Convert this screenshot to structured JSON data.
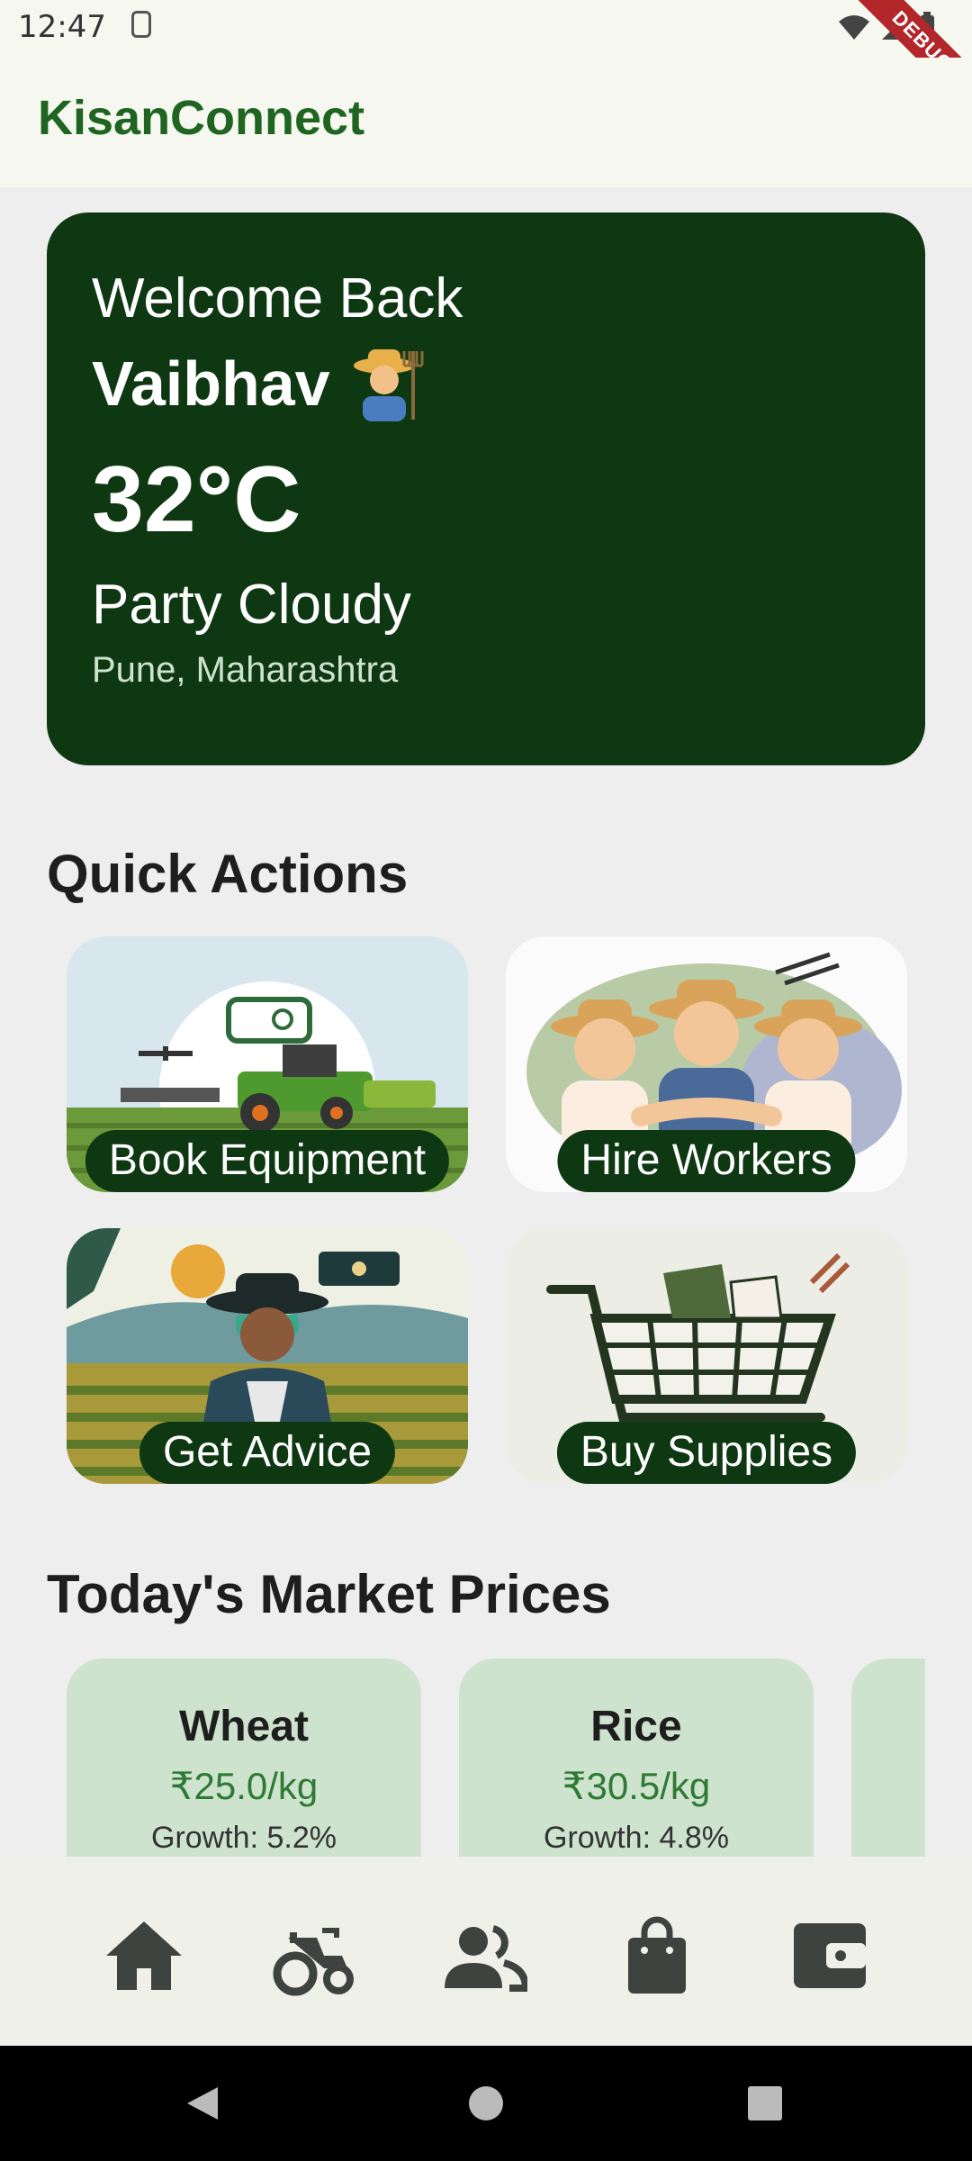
{
  "status": {
    "time": "12:47",
    "debug_label": "DEBUG"
  },
  "app": {
    "title": "KisanConnect"
  },
  "weather": {
    "greeting": "Welcome Back",
    "user_name": "Vaibhav",
    "temperature": "32°C",
    "condition": "Party Cloudy",
    "location": "Pune, Maharashtra"
  },
  "quick_actions": {
    "title": "Quick Actions",
    "items": [
      {
        "label": "Book Equipment",
        "icon": "tractor-illustration"
      },
      {
        "label": "Hire Workers",
        "icon": "workers-illustration"
      },
      {
        "label": "Get Advice",
        "icon": "farmer-advice-illustration"
      },
      {
        "label": "Buy Supplies",
        "icon": "shopping-cart-illustration"
      }
    ]
  },
  "market": {
    "title": "Today's Market Prices",
    "items": [
      {
        "name": "Wheat",
        "price": "₹25.0/kg",
        "growth": "Growth: 5.2%"
      },
      {
        "name": "Rice",
        "price": "₹30.5/kg",
        "growth": "Growth: 4.8%"
      }
    ]
  },
  "bottom_nav": [
    "home-icon",
    "tractor-icon",
    "people-icon",
    "shopping-bag-icon",
    "wallet-icon"
  ],
  "colors": {
    "primary": "#0e3812",
    "brand_text": "#1f6420",
    "card_bg": "#cde3cd",
    "price_text": "#2e7a34"
  }
}
